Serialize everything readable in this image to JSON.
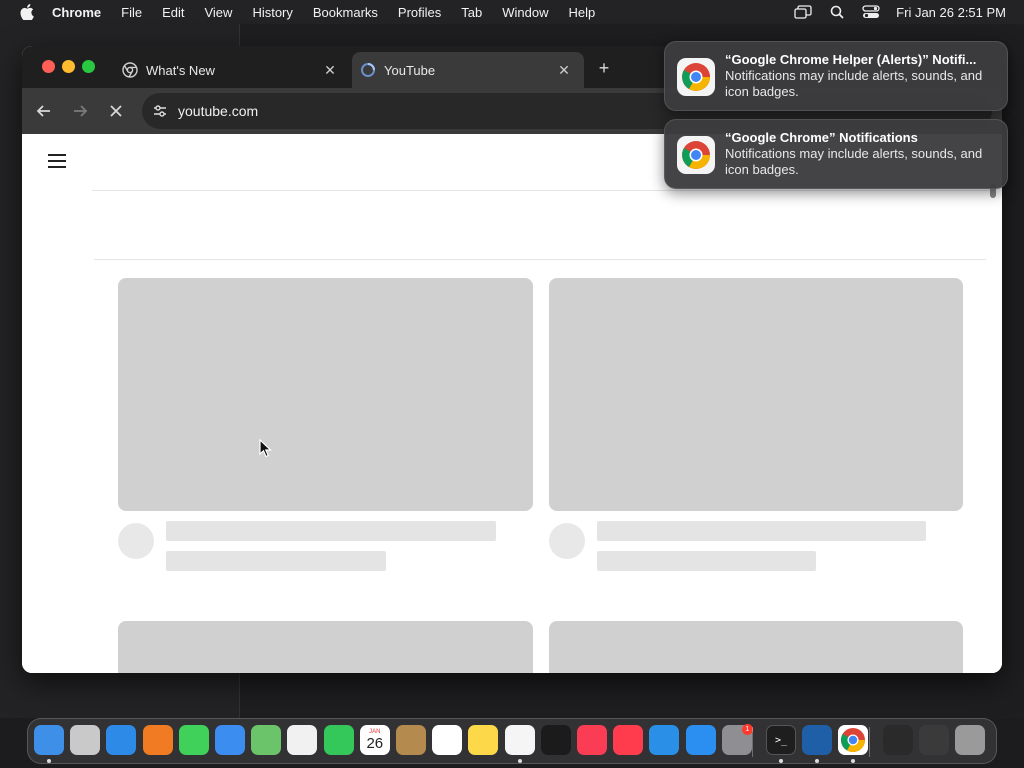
{
  "menubar": {
    "app_name": "Chrome",
    "items": [
      "File",
      "Edit",
      "View",
      "History",
      "Bookmarks",
      "Profiles",
      "Tab",
      "Window",
      "Help"
    ],
    "clock": "Fri Jan 26  2:51 PM",
    "status_icons": [
      "screen-mirroring-icon",
      "spotlight-search-icon",
      "control-center-icon"
    ]
  },
  "browser": {
    "tabs": [
      {
        "title": "What's New",
        "icon": "chrome-icon",
        "active": false
      },
      {
        "title": "YouTube",
        "icon": "loading-spinner-icon",
        "active": true
      }
    ],
    "address": "youtube.com",
    "toolbar_icons": [
      "back-arrow-icon",
      "forward-arrow-icon",
      "stop-loading-icon",
      "site-info-icon"
    ]
  },
  "notifications": [
    {
      "title": "“Google Chrome Helper (Alerts)” Notifi...",
      "body": "Notifications may include alerts, sounds, and icon badges.",
      "icon": "chrome-icon"
    },
    {
      "title": "“Google Chrome” Notifications",
      "body": "Notifications may include alerts, sounds, and icon badges.",
      "icon": "chrome-icon"
    }
  ],
  "dock": {
    "apps": [
      {
        "name": "finder-icon",
        "color": "#3d8fe8",
        "running": true
      },
      {
        "name": "launchpad-icon",
        "color": "#c9c9c9",
        "running": false
      },
      {
        "name": "safari-icon",
        "color": "#2d8ae6",
        "running": false
      },
      {
        "name": "firefox-icon",
        "color": "#f07b22",
        "running": false
      },
      {
        "name": "messages-icon",
        "color": "#3fd15a",
        "running": false
      },
      {
        "name": "mail-icon",
        "color": "#3b8df0",
        "running": false
      },
      {
        "name": "maps-icon",
        "color": "#6cc46a",
        "running": false
      },
      {
        "name": "photos-icon",
        "color": "#f1f1f1",
        "running": false
      },
      {
        "name": "facetime-icon",
        "color": "#34c759",
        "running": false
      },
      {
        "name": "calendar-icon",
        "color": "#ffffff",
        "running": false
      },
      {
        "name": "contacts-icon",
        "color": "#b58a4f",
        "running": false
      },
      {
        "name": "reminders-icon",
        "color": "#ffffff",
        "running": false
      },
      {
        "name": "notes-icon",
        "color": "#fdd94a",
        "running": false
      },
      {
        "name": "freeform-icon",
        "color": "#f5f5f5",
        "running": true
      },
      {
        "name": "apple-tv-icon",
        "color": "#1b1b1b",
        "running": false
      },
      {
        "name": "music-icon",
        "color": "#fa3c55",
        "running": false
      },
      {
        "name": "news-icon",
        "color": "#ff3b4e",
        "running": false
      },
      {
        "name": "keynote-icon",
        "color": "#2a8fe6",
        "running": false
      },
      {
        "name": "app-store-icon",
        "color": "#2a8ff0",
        "running": false
      },
      {
        "name": "system-settings-icon",
        "color": "#8e8e93",
        "running": false
      },
      {
        "name": "terminal-icon",
        "color": "#1e1e1e",
        "running": true
      },
      {
        "name": "virtualbox-icon",
        "color": "#1f5fa8",
        "running": true
      },
      {
        "name": "chrome-icon",
        "color": "#ffffff",
        "running": true
      },
      {
        "name": "wine-icon",
        "color": "#2a2a2a",
        "running": false
      },
      {
        "name": "screen-sharing-icon",
        "color": "#3a3a3a",
        "running": false
      },
      {
        "name": "trash-icon",
        "color": "#9a9a9a",
        "running": false
      }
    ],
    "calendar_month": "JAN",
    "calendar_day": "26",
    "settings_badge": "1"
  }
}
